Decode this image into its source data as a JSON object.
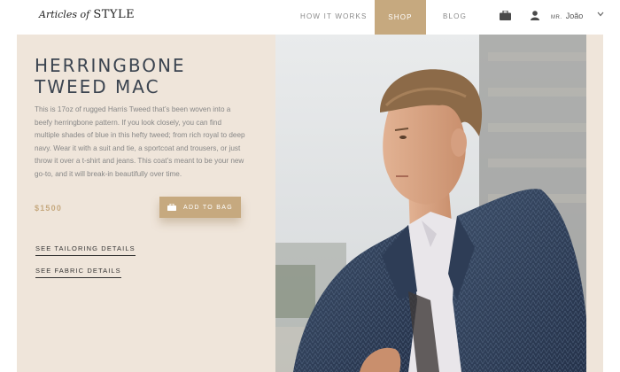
{
  "header": {
    "logo_script": "Articles of",
    "logo_caps": "STYLE",
    "nav": [
      {
        "label": "HOW IT WORKS"
      },
      {
        "label": "SHOP"
      },
      {
        "label": "BLOG"
      }
    ],
    "user": {
      "prefix": "MR.",
      "name": "João"
    },
    "icons": [
      "bag-icon",
      "user-icon",
      "chevron-down-icon"
    ]
  },
  "product": {
    "title": "HERRINGBONE TWEED MAC",
    "description": "This is 17oz of rugged Harris Tweed that’s been woven into a beefy herringbone pattern. If you look closely, you can find multiple shades of blue in this hefty tweed; from rich royal to deep navy. Wear it with a suit and tie, a sportcoat and trousers, or just throw it over a t-shirt and jeans. This coat’s meant to be your new go-to, and it will break-in beautifully over time.",
    "price": "$1500",
    "add_to_bag": "ADD TO BAG",
    "links": {
      "tailoring": "SEE TAILORING DETAILS",
      "fabric": "SEE FABRIC DETAILS"
    }
  },
  "colors": {
    "accent": "#c6a97f",
    "panel": "#efe5da",
    "title": "#3b4450"
  }
}
